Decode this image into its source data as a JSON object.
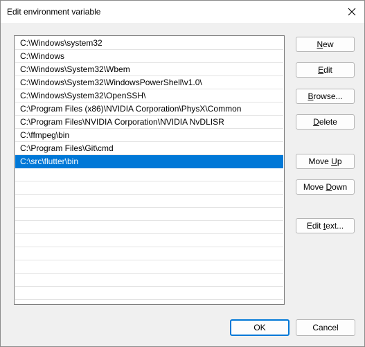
{
  "window": {
    "title": "Edit environment variable"
  },
  "paths": [
    "C:\\Windows\\system32",
    "C:\\Windows",
    "C:\\Windows\\System32\\Wbem",
    "C:\\Windows\\System32\\WindowsPowerShell\\v1.0\\",
    "C:\\Windows\\System32\\OpenSSH\\",
    "C:\\Program Files (x86)\\NVIDIA Corporation\\PhysX\\Common",
    "C:\\Program Files\\NVIDIA Corporation\\NVIDIA NvDLISR",
    "C:\\ffmpeg\\bin",
    "C:\\Program Files\\Git\\cmd",
    "C:\\src\\flutter\\bin",
    "",
    "",
    "",
    "",
    "",
    "",
    "",
    "",
    "",
    ""
  ],
  "selected_index": 9,
  "buttons": {
    "new": {
      "pre": "",
      "key": "N",
      "post": "ew"
    },
    "edit": {
      "pre": "",
      "key": "E",
      "post": "dit"
    },
    "browse": {
      "pre": "",
      "key": "B",
      "post": "rowse..."
    },
    "delete": {
      "pre": "",
      "key": "D",
      "post": "elete"
    },
    "move_up": {
      "pre": "Move ",
      "key": "U",
      "post": "p"
    },
    "move_down": {
      "pre": "Move ",
      "key": "D",
      "post": "own"
    },
    "edit_text": {
      "pre": "Edit ",
      "key": "t",
      "post": "ext..."
    }
  },
  "footer": {
    "ok_label": "OK",
    "cancel_label": "Cancel"
  },
  "colors": {
    "selection": "#0078d7",
    "default_button_border": "#0078d7"
  }
}
